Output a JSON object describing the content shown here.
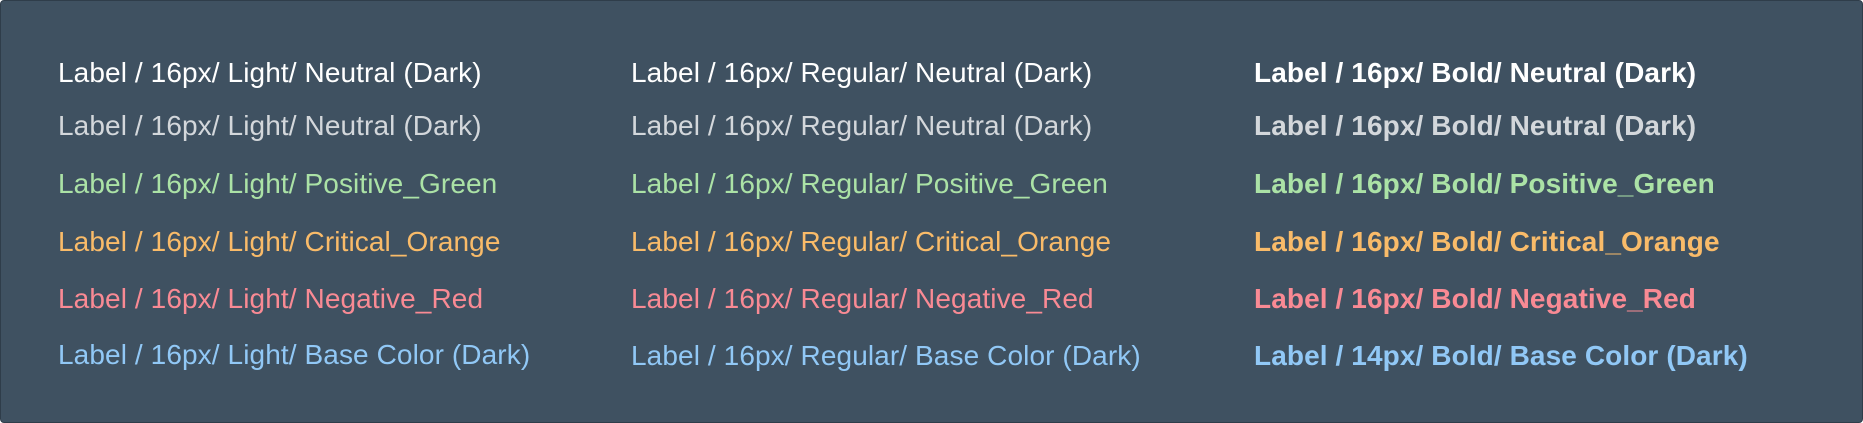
{
  "colors": {
    "background": "#3f5161",
    "neutral_dark_white": "#ffffff",
    "neutral_dark_gray": "#d3d7db",
    "positive_green": "#abe2a6",
    "critical_orange": "#f9bb69",
    "negative_red": "#f98a94",
    "base_color_dark": "#91c8f6"
  },
  "rows": [
    {
      "color": "#ffffff",
      "light": "Label / 16px/ Light/ Neutral (Dark)",
      "regular": "Label / 16px/ Regular/ Neutral (Dark)",
      "bold": "Label / 16px/ Bold/ Neutral (Dark)"
    },
    {
      "color": "#d3d7db",
      "light": "Label / 16px/ Light/ Neutral (Dark)",
      "regular": "Label / 16px/ Regular/ Neutral (Dark)",
      "bold": "Label / 16px/ Bold/ Neutral (Dark)"
    },
    {
      "color": "#abe2a6",
      "light": "Label / 16px/ Light/ Positive_Green",
      "regular": "Label / 16px/ Regular/ Positive_Green",
      "bold": "Label / 16px/ Bold/ Positive_Green"
    },
    {
      "color": "#f9bb69",
      "light": "Label / 16px/ Light/ Critical_Orange",
      "regular": "Label / 16px/ Regular/ Critical_Orange",
      "bold": "Label / 16px/ Bold/ Critical_Orange"
    },
    {
      "color": "#f98a94",
      "light": "Label / 16px/ Light/ Negative_Red",
      "regular": "Label / 16px/ Regular/ Negative_Red",
      "bold": "Label / 16px/ Bold/ Negative_Red"
    },
    {
      "color": "#91c8f6",
      "light": "Label / 16px/ Light/ Base Color (Dark)",
      "regular": "Label / 16px/ Regular/ Base Color (Dark)",
      "bold": "Label / 14px/ Bold/ Base Color (Dark)"
    }
  ]
}
